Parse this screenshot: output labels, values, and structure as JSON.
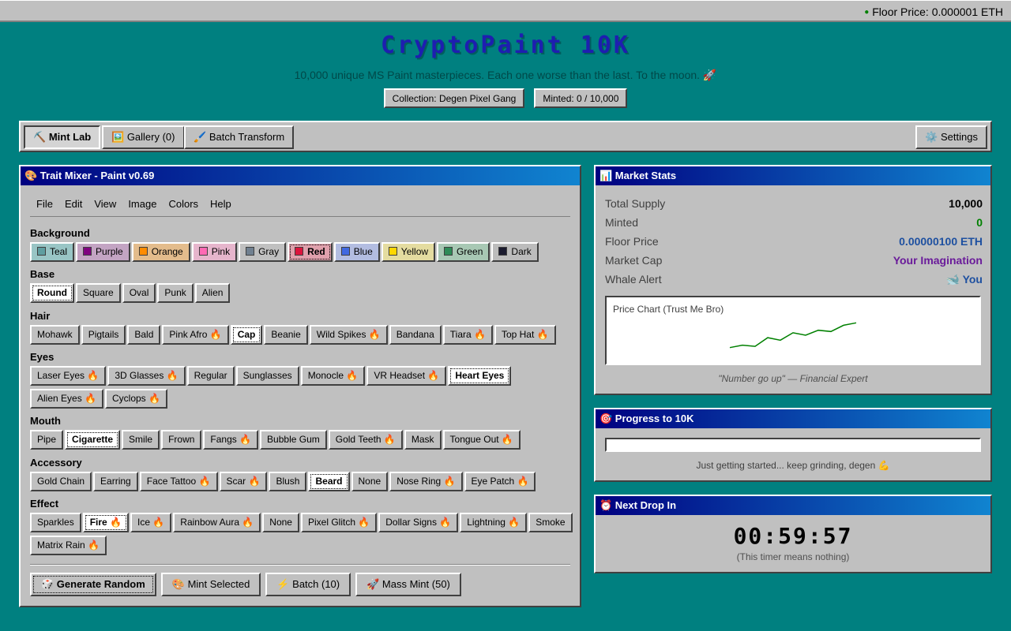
{
  "floor_status": {
    "dot": "●",
    "text": "Floor Price: 0.000001 ETH"
  },
  "header": {
    "title": "CryptoPaint 10K",
    "subtitle": "10,000 unique MS Paint masterpieces. Each one worse than the last. To the moon. 🚀",
    "collection": "Collection: Degen Pixel Gang",
    "minted": "Minted: 0 / 10,000"
  },
  "tabs": [
    {
      "icon": "⛏️",
      "label": "Mint Lab"
    },
    {
      "icon": "🖼️",
      "label": "Gallery (0)"
    },
    {
      "icon": "🖌️",
      "label": "Batch Transform"
    }
  ],
  "settings": {
    "icon": "⚙️",
    "label": "Settings"
  },
  "mixer": {
    "title": "🎨 Trait Mixer - Paint v0.69",
    "menu": [
      "File",
      "Edit",
      "View",
      "Image",
      "Colors",
      "Help"
    ],
    "categories": {
      "background": {
        "label": "Background",
        "options": [
          {
            "label": "Teal",
            "color": "#5f9ea0",
            "bg": "#99c5c5"
          },
          {
            "label": "Purple",
            "color": "#800080",
            "bg": "#c3a4c3"
          },
          {
            "label": "Orange",
            "color": "#ff8c00",
            "bg": "#e3bc8c"
          },
          {
            "label": "Pink",
            "color": "#ff69b4",
            "bg": "#e6b5cc"
          },
          {
            "label": "Gray",
            "color": "#708090",
            "bg": "#c0c0c0"
          },
          {
            "label": "Red",
            "color": "#dc143c",
            "bg": "#e0a0ac"
          },
          {
            "label": "Blue",
            "color": "#4169e1",
            "bg": "#b3bde1"
          },
          {
            "label": "Yellow",
            "color": "#ffd700",
            "bg": "#e4dca0"
          },
          {
            "label": "Green",
            "color": "#2e8b57",
            "bg": "#a8c8b4"
          },
          {
            "label": "Dark",
            "color": "#1a1a2e",
            "bg": "#bcbcbc"
          }
        ],
        "selected": "Red"
      },
      "base": {
        "label": "Base",
        "options": [
          "Round",
          "Square",
          "Oval",
          "Punk",
          "Alien"
        ],
        "selected": "Round"
      },
      "hair": {
        "label": "Hair",
        "options": [
          "Mohawk",
          "Pigtails",
          "Bald",
          "Pink Afro 🔥",
          "Cap",
          "Beanie",
          "Wild Spikes 🔥",
          "Bandana",
          "Tiara 🔥",
          "Top Hat 🔥"
        ],
        "selected": "Cap"
      },
      "eyes": {
        "label": "Eyes",
        "options": [
          "Laser Eyes 🔥",
          "3D Glasses 🔥",
          "Regular",
          "Sunglasses",
          "Monocle 🔥",
          "VR Headset 🔥",
          "Heart Eyes",
          "Alien Eyes 🔥",
          "Cyclops 🔥"
        ],
        "selected": "Heart Eyes"
      },
      "mouth": {
        "label": "Mouth",
        "options": [
          "Pipe",
          "Cigarette",
          "Smile",
          "Frown",
          "Fangs 🔥",
          "Bubble Gum",
          "Gold Teeth 🔥",
          "Mask",
          "Tongue Out 🔥"
        ],
        "selected": "Cigarette"
      },
      "accessory": {
        "label": "Accessory",
        "options": [
          "Gold Chain",
          "Earring",
          "Face Tattoo 🔥",
          "Scar 🔥",
          "Blush",
          "Beard",
          "None",
          "Nose Ring 🔥",
          "Eye Patch 🔥"
        ],
        "selected": "Beard"
      },
      "effect": {
        "label": "Effect",
        "options": [
          "Sparkles",
          "Fire 🔥",
          "Ice 🔥",
          "Rainbow Aura 🔥",
          "None",
          "Pixel Glitch 🔥",
          "Dollar Signs 🔥",
          "Lightning 🔥",
          "Smoke",
          "Matrix Rain 🔥"
        ],
        "selected": "Fire 🔥"
      }
    },
    "actions": [
      "🎲 Generate Random",
      "🎨 Mint Selected",
      "⚡ Batch (10)",
      "🚀 Mass Mint (50)"
    ]
  },
  "market": {
    "title": "📊 Market Stats",
    "stats": [
      {
        "label": "Total Supply",
        "value": "10,000",
        "color": "#000000"
      },
      {
        "label": "Minted",
        "value": "0",
        "color": "#008000"
      },
      {
        "label": "Floor Price",
        "value": "0.00000100 ETH",
        "color": "#1e50a0"
      },
      {
        "label": "Market Cap",
        "value": "Your Imagination",
        "color": "#6a1b9a"
      },
      {
        "label": "Whale Alert",
        "value": "🐋 You",
        "color": "#1e50a0"
      }
    ],
    "chart_title": "Price Chart (Trust Me Bro)",
    "quote": "\"Number go up\" — Financial Expert"
  },
  "chart_data": {
    "type": "line",
    "title": "Price Chart (Trust Me Bro)",
    "xlabel": "",
    "ylabel": "",
    "x": [
      0,
      1,
      2,
      3,
      4,
      5,
      6,
      7,
      8,
      9,
      10
    ],
    "values": [
      2,
      3,
      2.5,
      6,
      5,
      8,
      7,
      9,
      8.5,
      11,
      12
    ],
    "ylim": [
      0,
      14
    ],
    "grid": false,
    "color": "#008000"
  },
  "progress": {
    "title": "🎯 Progress to 10K",
    "percent": 0,
    "text": "Just getting started... keep grinding, degen 💪"
  },
  "drop": {
    "title": "⏰ Next Drop In",
    "timer": "00:59:57",
    "note": "(This timer means nothing)"
  }
}
